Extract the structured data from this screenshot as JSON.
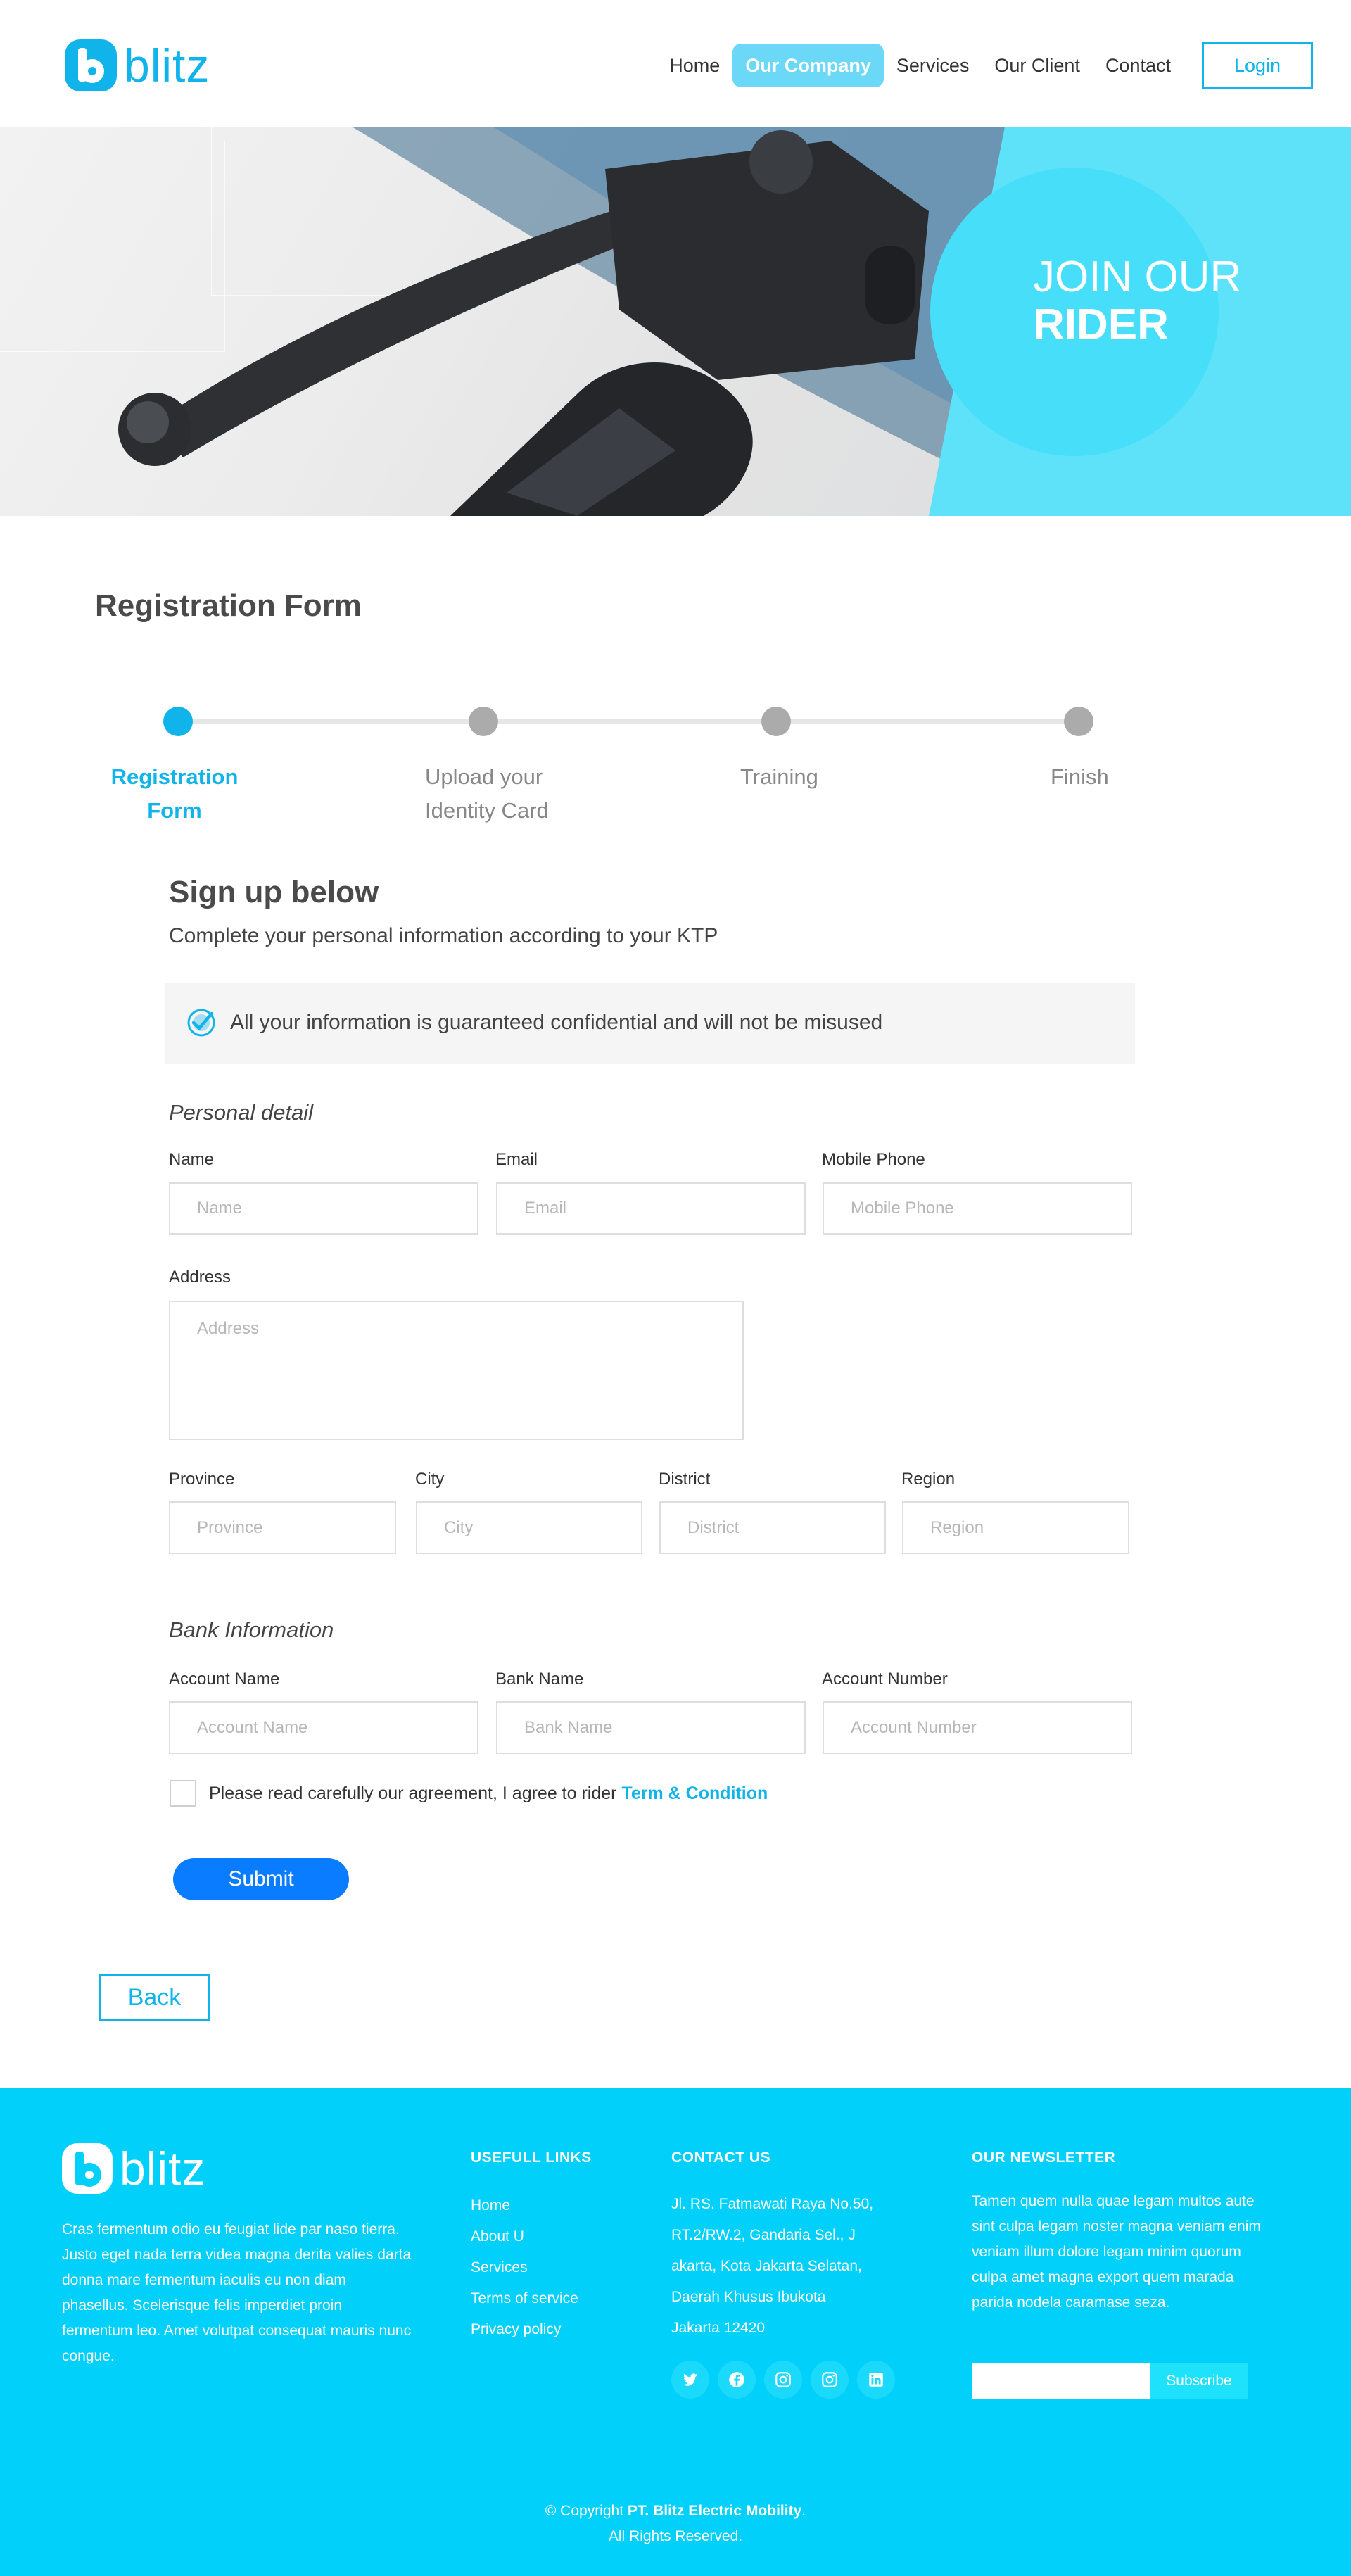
{
  "brand": {
    "name": "blitz",
    "accent": "#11b4ea",
    "footer_bg": "#00d0fa"
  },
  "nav": {
    "items": [
      "Home",
      "Our Company",
      "Services",
      "Our Client",
      "Contact"
    ],
    "active": "Our Company",
    "login_label": "Login"
  },
  "hero": {
    "line1": "JOIN OUR",
    "line2": "RIDER"
  },
  "registration": {
    "title": "Registration Form",
    "steps": [
      {
        "label": "Registration Form",
        "status": "active"
      },
      {
        "label": "Upload your Identity Card",
        "status": "pending"
      },
      {
        "label": "Training",
        "status": "pending"
      },
      {
        "label": "Finish",
        "status": "pending"
      }
    ],
    "signup_title": "Sign up below",
    "signup_subtitle": "Complete your personal information according to your KTP",
    "notice": "All your information is guaranteed confidential and will not be misused",
    "personal": {
      "heading": "Personal detail",
      "name_label": "Name",
      "name_placeholder": "Name",
      "email_label": "Email",
      "email_placeholder": "Email",
      "phone_label": "Mobile Phone",
      "phone_placeholder": "Mobile Phone",
      "address_label": "Address",
      "address_placeholder": "Address",
      "province_label": "Province",
      "province_placeholder": "Province",
      "city_label": "City",
      "city_placeholder": "City",
      "district_label": "District",
      "district_placeholder": "District",
      "region_label": "Region",
      "region_placeholder": "Region"
    },
    "bank": {
      "heading": "Bank Information",
      "account_name_label": "Account Name",
      "account_name_placeholder": "Account Name",
      "bank_name_label": "Bank Name",
      "bank_name_placeholder": "Bank Name",
      "account_number_label": "Account Number",
      "account_number_placeholder": "Account Number"
    },
    "agreement_text": "Please read carefully our agreement, I agree to rider ",
    "agreement_link": "Term & Condition",
    "submit_label": "Submit",
    "back_label": "Back"
  },
  "footer": {
    "about": "Cras fermentum odio eu feugiat lide par naso tierra. Justo eget nada terra videa magna derita valies darta donna mare fermentum iaculis eu non diam phasellus. Scelerisque felis imperdiet proin fermentum leo. Amet volutpat consequat mauris nunc congue.",
    "links_heading": "USEFULL LINKS",
    "links": [
      "Home",
      "About U",
      "Services",
      "Terms of service",
      "Privacy policy"
    ],
    "contact_heading": "CONTACT US",
    "contact_lines": [
      "Jl. RS. Fatmawati Raya No.50,",
      "RT.2/RW.2, Gandaria Sel., J",
      "akarta, Kota Jakarta Selatan,",
      "Daerah Khusus Ibukota",
      "Jakarta 12420"
    ],
    "socials": [
      "twitter-icon",
      "facebook-icon",
      "instagram-icon",
      "instagram-icon",
      "linkedin-icon"
    ],
    "newsletter_heading": "OUR NEWSLETTER",
    "newsletter_text": "Tamen quem nulla quae legam multos aute sint culpa legam noster magna veniam enim veniam illum dolore legam minim quorum culpa amet magna export quem marada parida nodela caramase seza.",
    "subscribe_label": "Subscribe",
    "copyright_prefix": "© Copyright ",
    "copyright_company": "PT. Blitz Electric Mobility",
    "copyright_suffix": ".",
    "rights": "All Rights Reserved."
  }
}
